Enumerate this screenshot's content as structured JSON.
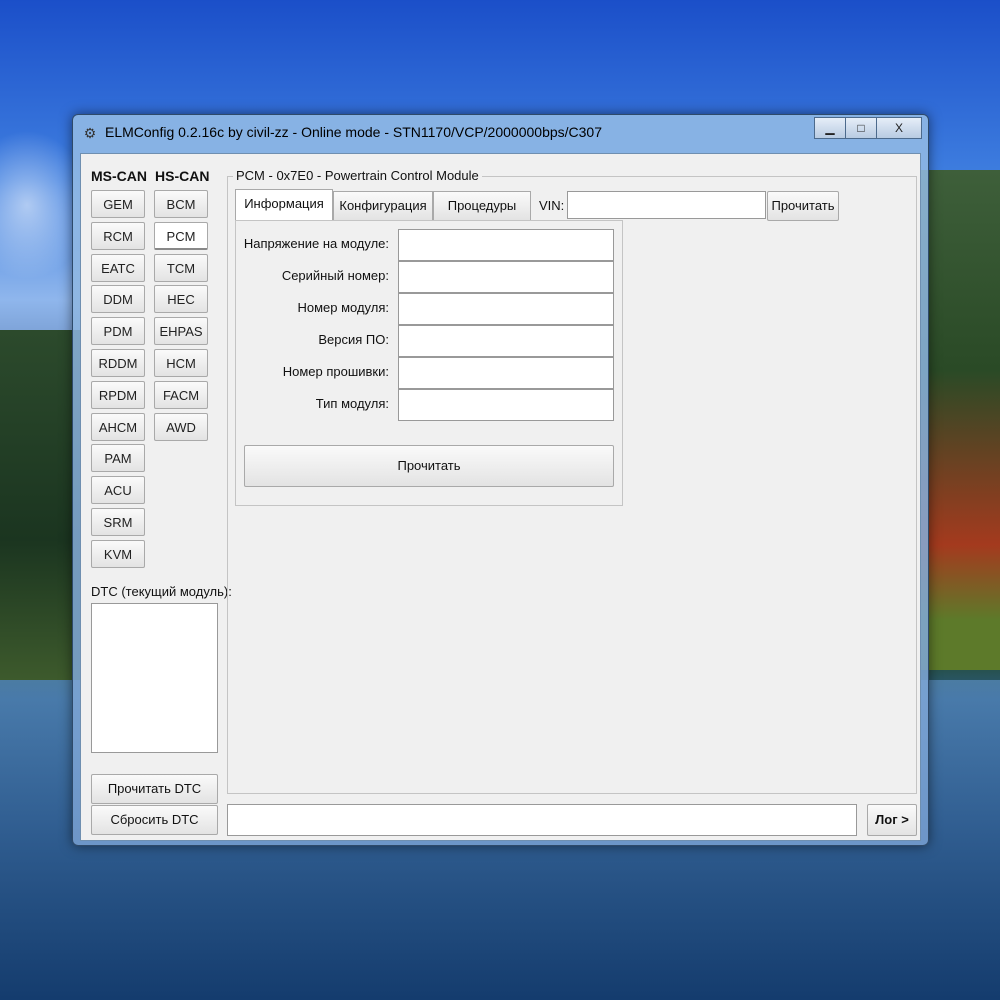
{
  "window": {
    "title": "ELMConfig 0.2.16c by civil-zz - Online mode - STN1170/VCP/2000000bps/C307",
    "minimize": "▁",
    "maximize": "□",
    "close": "X"
  },
  "modules": {
    "ms_can_header": "MS-CAN",
    "hs_can_header": "HS-CAN",
    "ms_can": [
      "GEM",
      "RCM",
      "EATC",
      "DDM",
      "PDM",
      "RDDM",
      "RPDM",
      "AHCM",
      "PAM",
      "ACU",
      "SRM",
      "KVM"
    ],
    "hs_can": [
      "BCM",
      "PCM",
      "TCM",
      "HEC",
      "EHPAS",
      "HCM",
      "FACM",
      "AWD"
    ],
    "active_hs": "PCM"
  },
  "dtc": {
    "label": "DTC (текущий модуль):",
    "read_button": "Прочитать DTC",
    "reset_button": "Сбросить DTC"
  },
  "module_panel": {
    "title": "PCM - 0x7E0 - Powertrain Control Module",
    "tabs": [
      "Информация",
      "Конфигурация",
      "Процедуры"
    ],
    "active_tab": "Информация",
    "vin_label": "VIN:",
    "vin_value": "",
    "vin_read_button": "Прочитать"
  },
  "info": {
    "fields": [
      {
        "label": "Напряжение на модуле:",
        "value": ""
      },
      {
        "label": "Серийный номер:",
        "value": ""
      },
      {
        "label": "Номер модуля:",
        "value": ""
      },
      {
        "label": "Версия ПО:",
        "value": ""
      },
      {
        "label": "Номер прошивки:",
        "value": ""
      },
      {
        "label": "Тип модуля:",
        "value": ""
      }
    ],
    "read_button": "Прочитать"
  },
  "status": {
    "value": "",
    "log_button": "Лог >"
  }
}
